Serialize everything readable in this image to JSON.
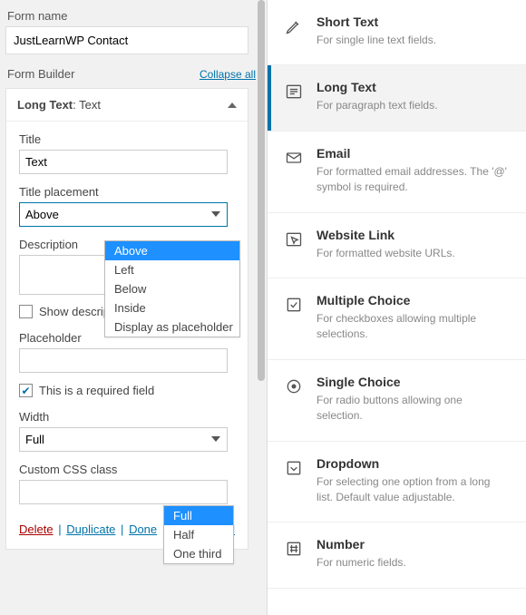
{
  "form_name_label": "Form name",
  "form_name_value": "JustLearnWP Contact",
  "builder_heading": "Form Builder",
  "collapse_label": "Collapse all",
  "field": {
    "type_label": "Long Text",
    "type_suffix": ": Text",
    "title_label": "Title",
    "title_value": "Text",
    "placement_label": "Title placement",
    "placement_value": "Above",
    "placement_options": [
      "Above",
      "Left",
      "Below",
      "Inside",
      "Display as placeholder"
    ],
    "description_label": "Description",
    "tooltip_cb_label": "Show description in a tooltip",
    "tooltip_checked": false,
    "placeholder_label": "Placeholder",
    "required_label": "This is a required field",
    "required_checked": true,
    "width_label": "Width",
    "width_value": "Full",
    "width_options": [
      "Full",
      "Half",
      "One third"
    ],
    "css_label": "Custom CSS class"
  },
  "footer": {
    "delete": "Delete",
    "duplicate": "Duplicate",
    "done": "Done",
    "advanced": "Advanced"
  },
  "field_types": [
    {
      "id": "short-text",
      "title": "Short Text",
      "desc": "For single line text fields.",
      "icon": "pencil",
      "active": false
    },
    {
      "id": "long-text",
      "title": "Long Text",
      "desc": "For paragraph text fields.",
      "icon": "paragraph",
      "active": true
    },
    {
      "id": "email",
      "title": "Email",
      "desc": "For formatted email addresses. The '@' symbol is required.",
      "icon": "mail",
      "active": false
    },
    {
      "id": "website-link",
      "title": "Website Link",
      "desc": "For formatted website URLs.",
      "icon": "cursor",
      "active": false
    },
    {
      "id": "multiple-choice",
      "title": "Multiple Choice",
      "desc": "For checkboxes allowing multiple selections.",
      "icon": "checkbox",
      "active": false
    },
    {
      "id": "single-choice",
      "title": "Single Choice",
      "desc": "For radio buttons allowing one selection.",
      "icon": "radio",
      "active": false
    },
    {
      "id": "dropdown",
      "title": "Dropdown",
      "desc": "For selecting one option from a long list. Default value adjustable.",
      "icon": "dropdown",
      "active": false
    },
    {
      "id": "number",
      "title": "Number",
      "desc": "For numeric fields.",
      "icon": "hash",
      "active": false
    }
  ]
}
